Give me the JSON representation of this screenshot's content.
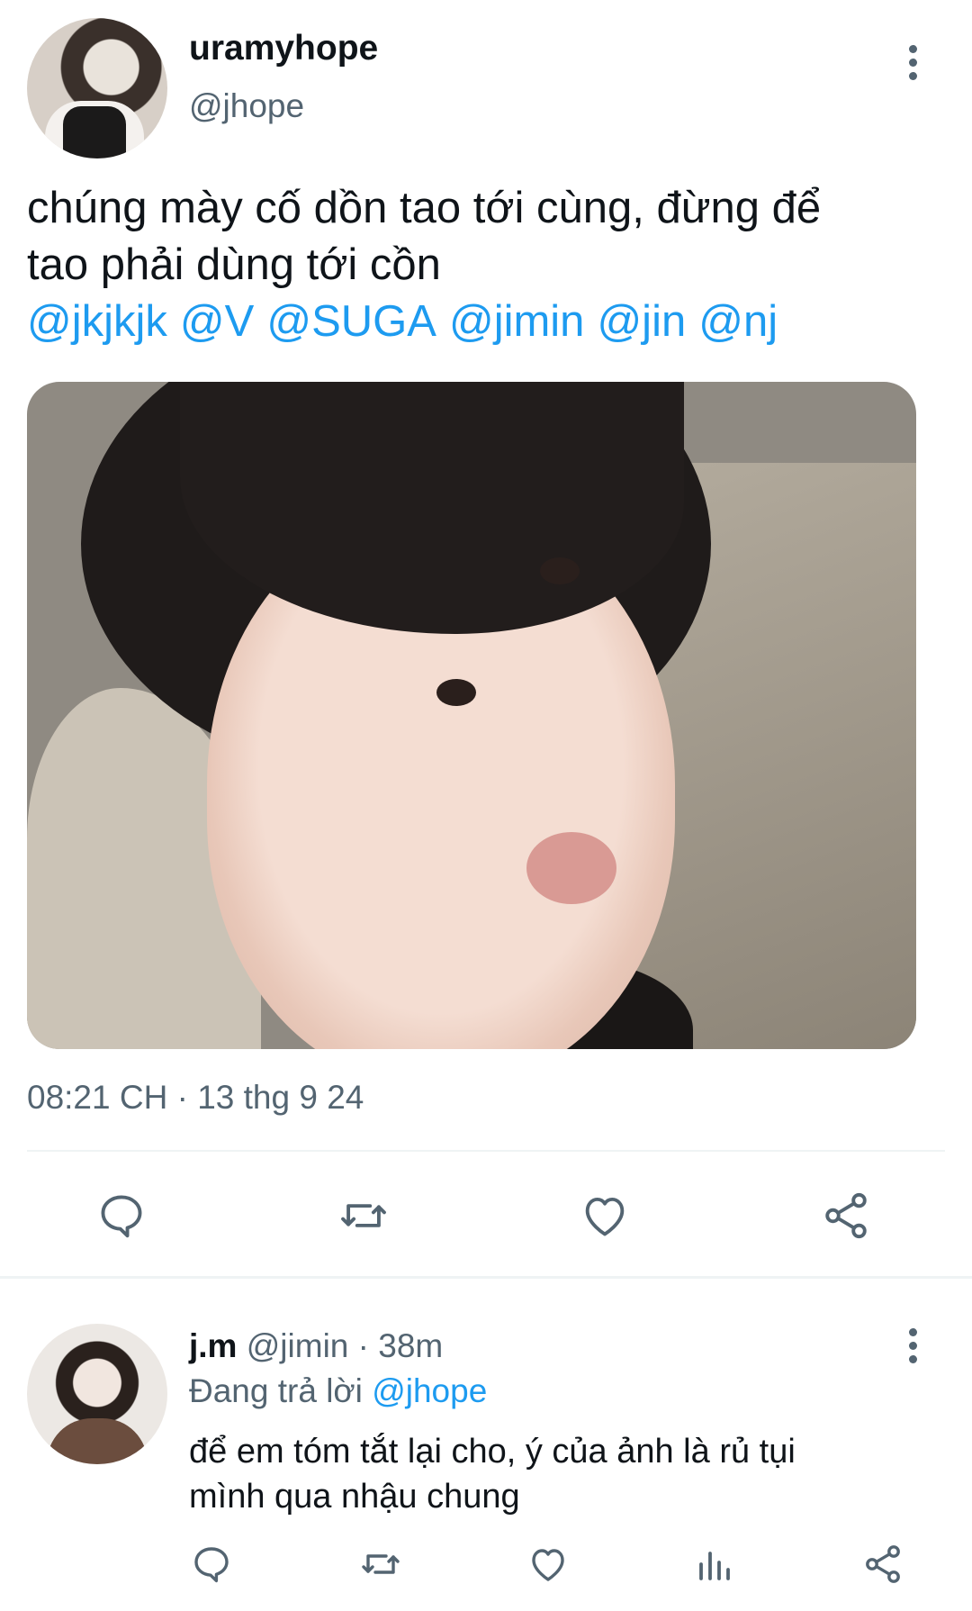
{
  "tweet": {
    "display_name": "uramyhope",
    "handle": "@jhope",
    "text_lines": [
      "chúng mày cố dồn tao tới cùng, đừng để",
      "tao phải dùng tới cồn"
    ],
    "mentions": [
      "@jkjkjk",
      "@V",
      "@SUGA",
      "@jimin",
      "@jin",
      "@nj"
    ],
    "timestamp": "08:21 CH · 13 thg 9 24"
  },
  "reply": {
    "display_name": "j.m",
    "handle": "@jimin",
    "time": "· 38m",
    "replying_prefix": "Đang trả lời",
    "replying_to": "@jhope",
    "text_lines": [
      "để em tóm tắt lại cho, ý của ảnh là rủ tụi",
      "mình qua nhậu chung"
    ]
  },
  "colors": {
    "accent": "#1d9bf0",
    "secondary_text": "#536471",
    "primary_text": "#0f1419"
  },
  "icons": {
    "main_actions": [
      "reply-icon",
      "retweet-icon",
      "like-icon",
      "share-icon"
    ],
    "reply_actions": [
      "reply-icon",
      "retweet-icon",
      "like-icon",
      "views-icon",
      "share-icon"
    ]
  }
}
